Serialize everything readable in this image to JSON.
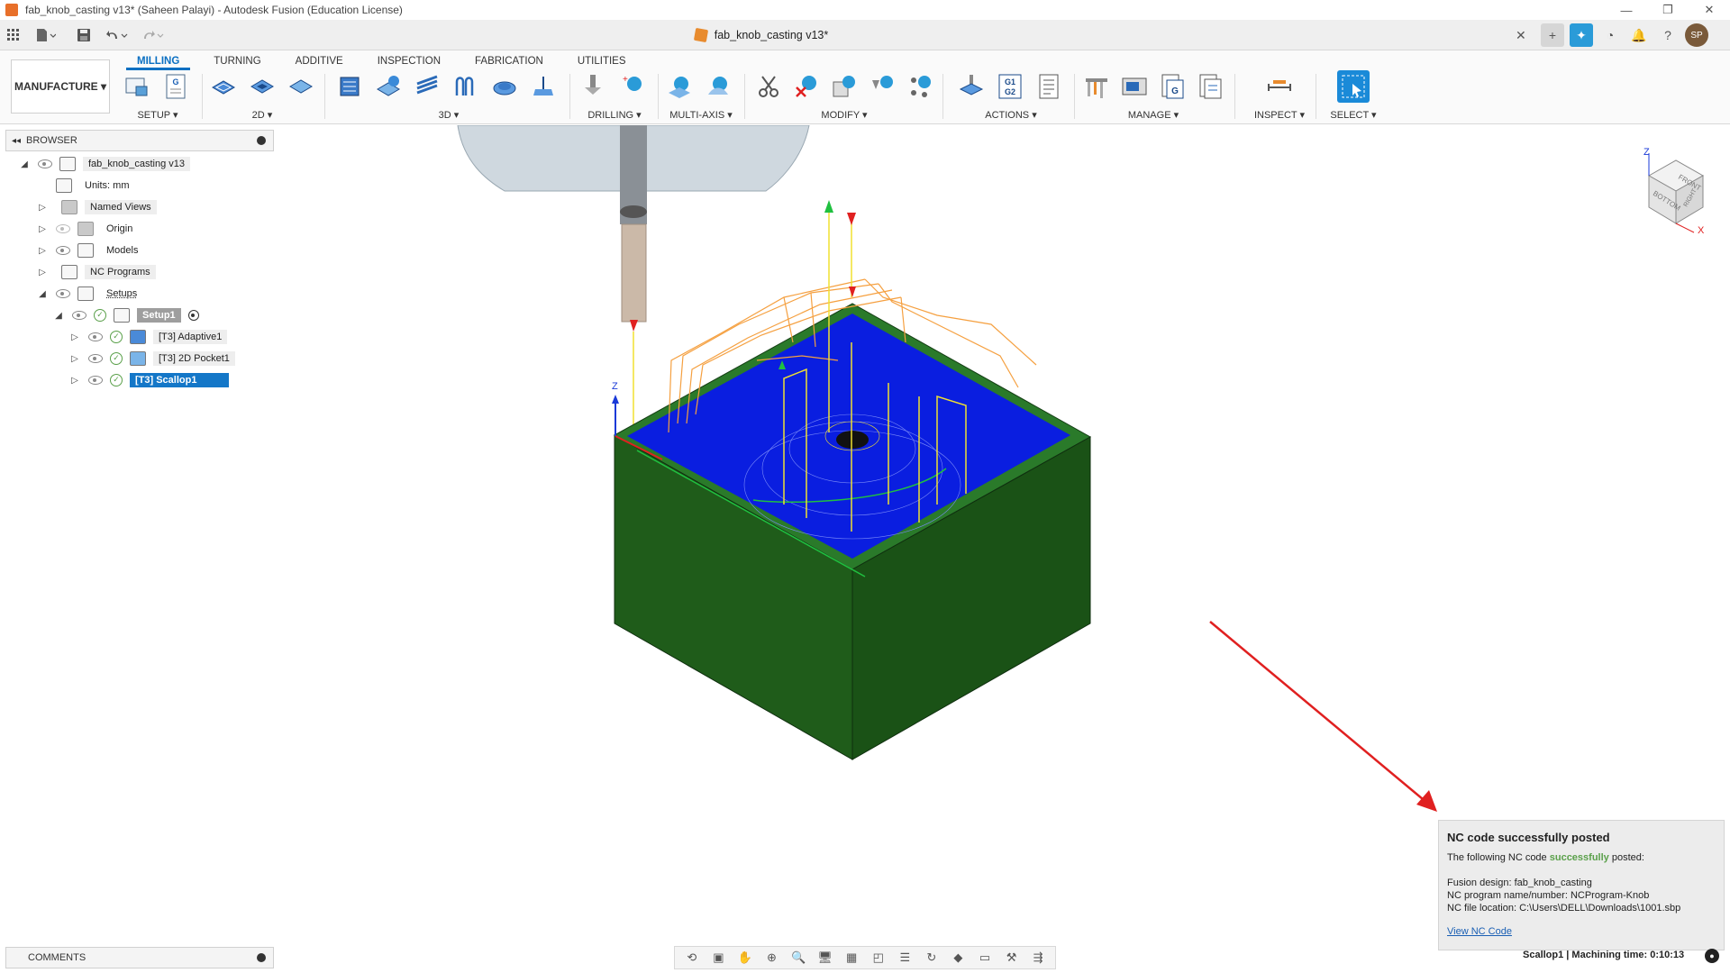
{
  "window": {
    "title": "fab_knob_casting v13* (Saheen Palayi) - Autodesk Fusion (Education License)",
    "controls": [
      "—",
      "❐",
      "✕"
    ]
  },
  "qat": {
    "grid_icon": "grid-icon",
    "file_icon": "file-icon",
    "save_icon": "save-icon",
    "undo_icon": "undo-icon",
    "redo_icon": "redo-icon"
  },
  "doc_tab": {
    "name": "fab_knob_casting v13*",
    "close": "✕"
  },
  "workspace": {
    "label": "MANUFACTURE ▾"
  },
  "tabs": [
    {
      "label": "MILLING",
      "active": true
    },
    {
      "label": "TURNING"
    },
    {
      "label": "ADDITIVE"
    },
    {
      "label": "INSPECTION"
    },
    {
      "label": "FABRICATION"
    },
    {
      "label": "UTILITIES"
    }
  ],
  "groups": {
    "setup": "SETUP ▾",
    "twod": "2D ▾",
    "threed": "3D ▾",
    "drilling": "DRILLING ▾",
    "multiaxis": "MULTI-AXIS ▾",
    "modify": "MODIFY ▾",
    "actions": "ACTIONS ▾",
    "manage": "MANAGE ▾",
    "inspect": "INSPECT ▾",
    "select": "SELECT ▾"
  },
  "actions_g1g2": {
    "line1": "G1",
    "line2": "G2"
  },
  "setup_g": "G",
  "browser": {
    "title": "BROWSER",
    "root": "fab_knob_casting v13",
    "units": "Units: mm",
    "named_views": "Named Views",
    "origin": "Origin",
    "models": "Models",
    "nc_programs": "NC Programs",
    "setups": "Setups",
    "setup1": "Setup1",
    "op1": "[T3] Adaptive1",
    "op2": "[T3] 2D Pocket1",
    "op3": "[T3] Scallop1"
  },
  "comments": {
    "title": "COMMENTS"
  },
  "viewcube": {
    "front": "FRONT",
    "bottom": "BOTTOM",
    "right": "RIGHT",
    "z": "Z",
    "x": "X"
  },
  "triad": {
    "z": "Z"
  },
  "notification": {
    "title": "NC code successfully posted",
    "intro_prefix": "The following NC code ",
    "intro_green": "successfully",
    "intro_suffix": " posted:",
    "design": "Fusion design: fab_knob_casting",
    "program": "NC program name/number: NCProgram-Knob",
    "location": "NC file location: C:\\Users\\DELL\\Downloads\\1001.sbp",
    "link": "View NC Code"
  },
  "status": {
    "text": "Scallop1 | Machining time: 0:10:13"
  },
  "colors": {
    "accent": "#0a6fc2",
    "stock_green": "#1f5c1a",
    "toolpath_blue": "#0a1ee0",
    "toolpath_orange": "#f5a040",
    "success_green": "#5aa04a",
    "arrow_red": "#e02020"
  }
}
